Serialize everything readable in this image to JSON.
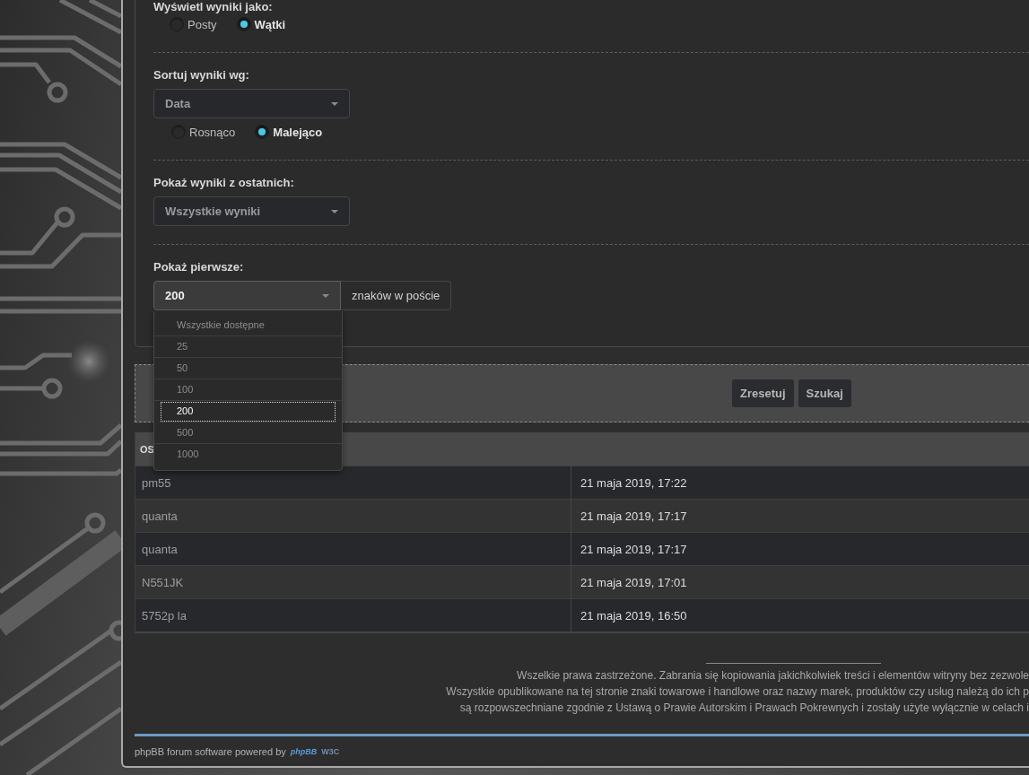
{
  "search_options": [
    {
      "kind": "radio",
      "label": "Wyświetl wyniki jako:",
      "options": [
        {
          "label": "Posty",
          "selected": false
        },
        {
          "label": "Wątki",
          "selected": true
        }
      ]
    },
    {
      "kind": "select",
      "label": "Sortuj wyniki wg:",
      "value": "Data",
      "expanded": false,
      "options": [
        {
          "label": "Rosnąco",
          "selected": false
        },
        {
          "label": "Malejąco",
          "selected": true
        }
      ]
    },
    {
      "kind": "select",
      "label": "Pokaż wyniki z ostatnich:",
      "value": "Wszystkie wyniki",
      "expanded": false
    },
    {
      "kind": "select",
      "label": "Pokaż pierwsze:",
      "value": "200",
      "suffix": "znaków w poście",
      "expanded": true,
      "dropdown": [
        {
          "label": "Wszystkie dostępne",
          "selected": false
        },
        {
          "label": "25",
          "selected": false
        },
        {
          "label": "50",
          "selected": false
        },
        {
          "label": "100",
          "selected": false
        },
        {
          "label": "200",
          "selected": true
        },
        {
          "label": "500",
          "selected": false
        },
        {
          "label": "1000",
          "selected": false
        }
      ]
    }
  ],
  "buttons": [
    "Zresetuj",
    "Szukaj"
  ],
  "results_table": {
    "columns": [
      "OS"
    ],
    "rows": [
      [
        "pm55",
        "21 maja 2019, 17:22"
      ],
      [
        "quanta",
        "21 maja 2019, 17:17"
      ],
      [
        "quanta",
        "21 maja 2019, 17:17"
      ],
      [
        "N551JK",
        "21 maja 2019, 17:01"
      ],
      [
        "5752p la",
        "21 maja 2019, 16:50"
      ]
    ]
  },
  "footer": {
    "copyright_lines": [
      "Wszelkie prawa zastrzeżone. Zabrania się kopiowania jakichkolwiek treści i elementów witryny bez zezwole",
      "Wszystkie opublikowane na tej stronie znaki towarowe i handlowe oraz nazwy marek, produktów czy usług należą do ich p",
      "są rozpowszechniane zgodnie z Ustawą o Prawie Autorskim i Prawach Pokrewnych i zostały użyte wyłącznie w celach i"
    ],
    "powered_by": "phpBB forum software powered by",
    "logos": [
      "phpBB",
      "W3C"
    ]
  }
}
